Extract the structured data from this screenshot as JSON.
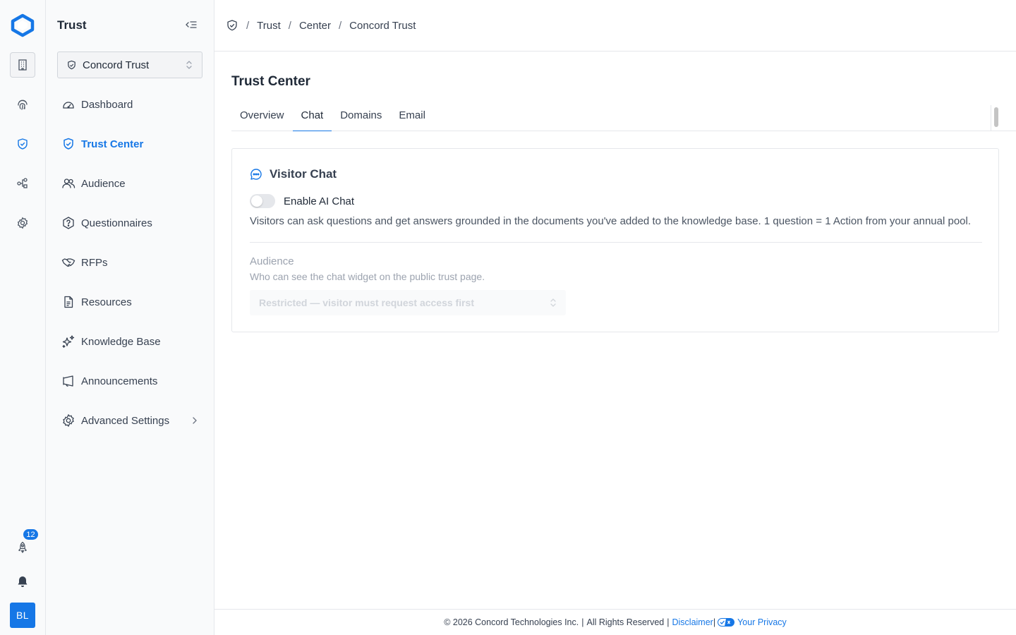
{
  "rail": {
    "items": [
      "building-icon",
      "fingerprint-icon",
      "shield-check-icon",
      "workflow-icon",
      "settings-icon"
    ],
    "notification_count": "12",
    "user_initials": "BL"
  },
  "sidebar": {
    "title": "Trust",
    "org_selector": {
      "value": "Concord Trust"
    },
    "items": [
      {
        "label": "Dashboard",
        "icon": "gauge-icon"
      },
      {
        "label": "Trust Center",
        "icon": "shield-check-icon",
        "active": true
      },
      {
        "label": "Audience",
        "icon": "users-icon"
      },
      {
        "label": "Questionnaires",
        "icon": "hex-question-icon"
      },
      {
        "label": "RFPs",
        "icon": "handshake-icon"
      },
      {
        "label": "Resources",
        "icon": "document-icon"
      },
      {
        "label": "Knowledge Base",
        "icon": "sparkles-icon"
      },
      {
        "label": "Announcements",
        "icon": "megaphone-icon"
      },
      {
        "label": "Advanced Settings",
        "icon": "gear-icon",
        "expandable": true
      }
    ]
  },
  "breadcrumb": [
    "Trust",
    "Center",
    "Concord Trust"
  ],
  "page": {
    "title": "Trust Center",
    "tabs": [
      {
        "label": "Overview"
      },
      {
        "label": "Chat",
        "active": true
      },
      {
        "label": "Domains"
      },
      {
        "label": "Email"
      }
    ]
  },
  "chat_card": {
    "title": "Visitor Chat",
    "toggle_label": "Enable AI Chat",
    "toggle_on": false,
    "description": "Visitors can ask questions and get answers grounded in the documents you've added to the knowledge base. 1 question = 1 Action from your annual pool.",
    "audience_label": "Audience",
    "audience_help": "Who can see the chat widget on the public trust page.",
    "audience_value": "Restricted — visitor must request access first"
  },
  "footer": {
    "copyright": "© 2026 Concord Technologies Inc.",
    "rights": "All Rights Reserved",
    "disclaimer": "Disclaimer",
    "privacy": "Your Privacy"
  },
  "colors": {
    "accent": "#1677e6",
    "sidebar_bg": "#f9fafb",
    "border": "#e5e7eb"
  }
}
